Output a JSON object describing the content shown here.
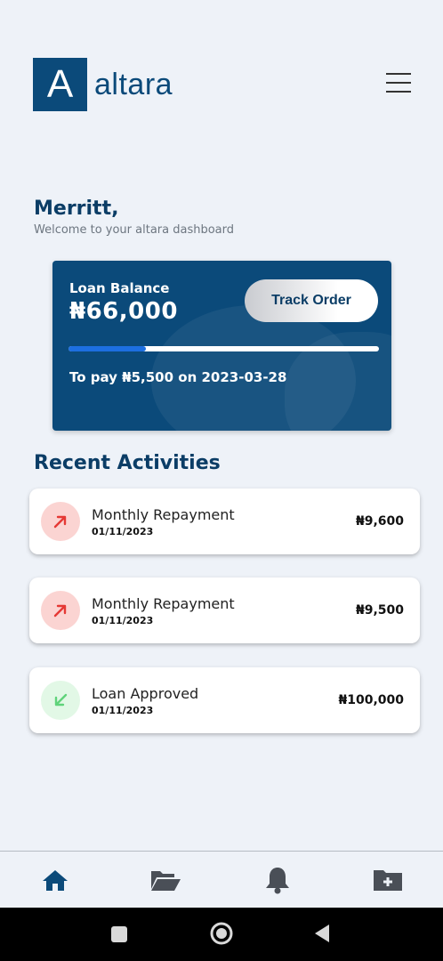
{
  "brand": {
    "logo_letter": "A",
    "name": "altara"
  },
  "greeting": {
    "name": "Merritt,",
    "subtitle": "Welcome to your altara dashboard"
  },
  "loan_card": {
    "label": "Loan Balance",
    "amount": "₦66,000",
    "track_button": "Track Order",
    "progress_fraction": 0.25,
    "to_pay": "To pay ₦5,500 on 2023-03-28"
  },
  "recent": {
    "title": "Recent Activities",
    "items": [
      {
        "title": "Monthly Repayment",
        "date": "01/11/2023",
        "amount": "₦9,600",
        "icon": "arrow-up-right-icon",
        "kind": "out"
      },
      {
        "title": "Monthly Repayment",
        "date": "01/11/2023",
        "amount": "₦9,500",
        "icon": "arrow-up-right-icon",
        "kind": "out"
      },
      {
        "title": "Loan Approved",
        "date": "01/11/2023",
        "amount": "₦100,000",
        "icon": "arrow-down-left-icon",
        "kind": "in"
      }
    ]
  },
  "bottom_nav": [
    "home-icon",
    "folder-open-icon",
    "bell-icon",
    "folder-plus-icon"
  ],
  "colors": {
    "primary": "#0b4a7a",
    "accent_progress": "#1d6fe0",
    "out_bg": "#fbd4d2",
    "out_arrow": "#e53935",
    "in_bg": "#e2f8e6",
    "in_arrow": "#5fd37a"
  }
}
